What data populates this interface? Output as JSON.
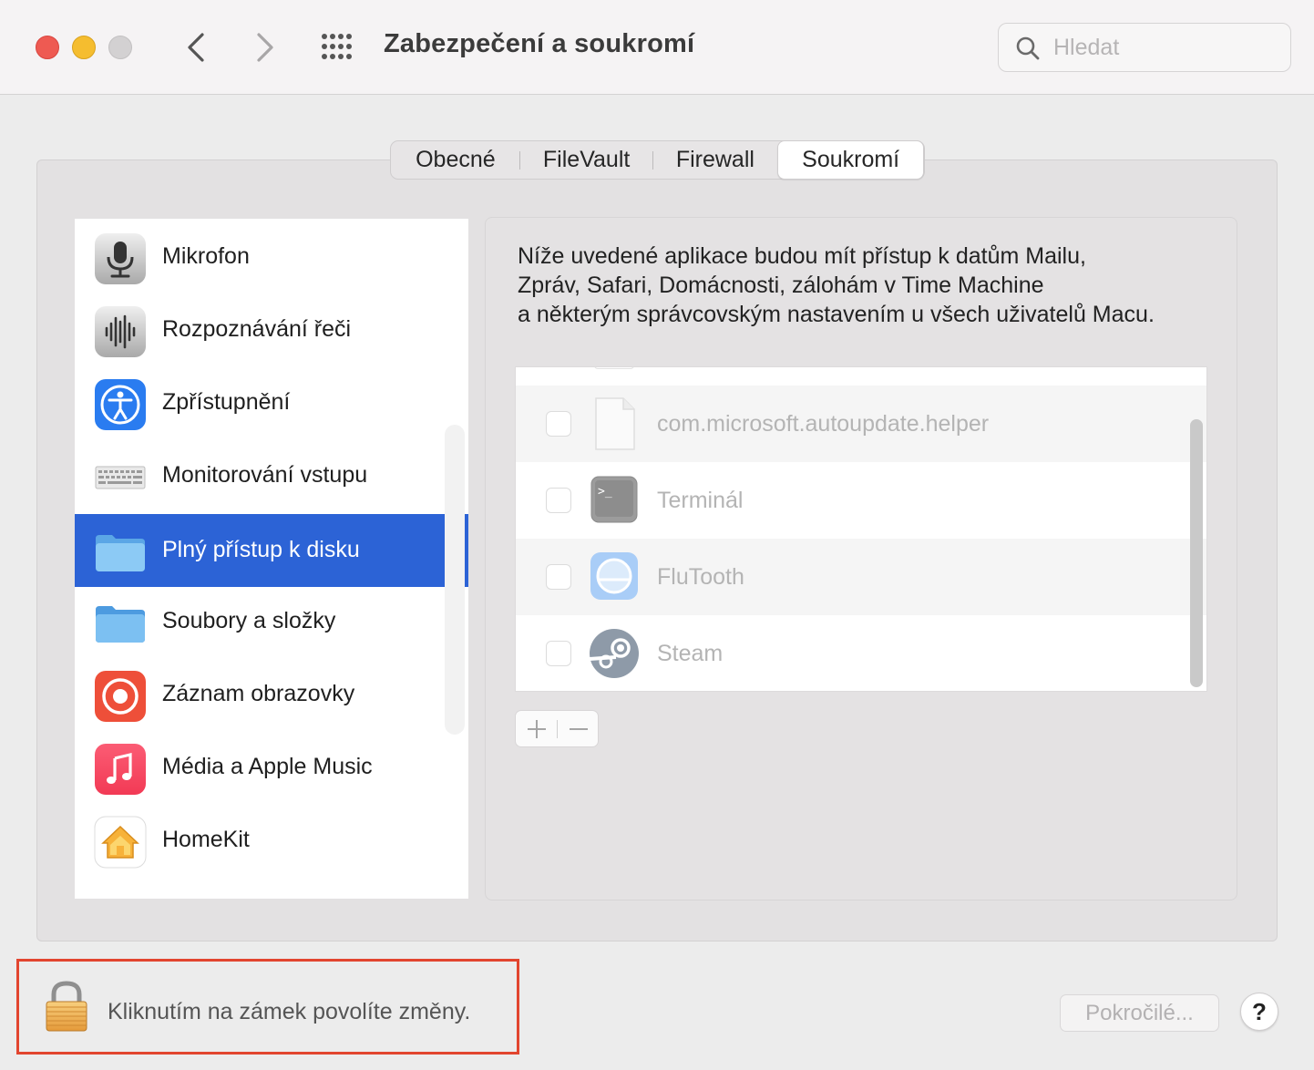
{
  "window": {
    "title": "Zabezpečení a soukromí"
  },
  "search": {
    "placeholder": "Hledat",
    "value": ""
  },
  "tabs": [
    {
      "label": "Obecné",
      "active": false
    },
    {
      "label": "FileVault",
      "active": false
    },
    {
      "label": "Firewall",
      "active": false
    },
    {
      "label": "Soukromí",
      "active": true
    }
  ],
  "sidebar": {
    "items": [
      {
        "label": "Mikrofon",
        "icon": "microphone-icon"
      },
      {
        "label": "Rozpoznávání řeči",
        "icon": "speech-recognition-icon"
      },
      {
        "label": "Zpřístupnění",
        "icon": "accessibility-icon"
      },
      {
        "label": "Monitorování vstupu",
        "icon": "keyboard-icon"
      },
      {
        "label": "Plný přístup k disku",
        "icon": "folder-icon",
        "selected": true
      },
      {
        "label": "Soubory a složky",
        "icon": "folder-icon"
      },
      {
        "label": "Záznam obrazovky",
        "icon": "screen-recording-icon"
      },
      {
        "label": "Média a Apple Music",
        "icon": "music-icon"
      },
      {
        "label": "HomeKit",
        "icon": "homekit-icon"
      }
    ]
  },
  "description": {
    "line1": "Níže uvedené aplikace budou mít přístup k datům Mailu,",
    "line2": "Zpráv, Safari, Domácnosti, zálohám v Time Machine",
    "line3": "a některým správcovským nastavením u všech uživatelů Macu."
  },
  "apps": [
    {
      "name": "com.microsoft.autoupdate.helper",
      "icon": "document-icon",
      "checked": false
    },
    {
      "name": "Terminál",
      "icon": "terminal-icon",
      "checked": false
    },
    {
      "name": "FluTooth",
      "icon": "flutooth-icon",
      "checked": false
    },
    {
      "name": "Steam",
      "icon": "steam-icon",
      "checked": false
    }
  ],
  "footer": {
    "lock_text": "Kliknutím na zámek povolíte změny.",
    "advanced_label": "Pokročilé...",
    "help_label": "?"
  },
  "colors": {
    "selection": "#2c63d6",
    "highlight_border": "#e2452f"
  }
}
